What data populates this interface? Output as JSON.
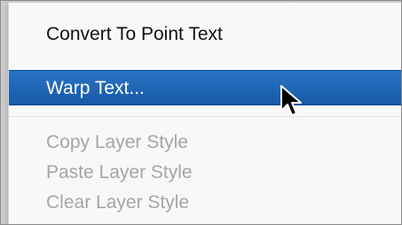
{
  "menu": {
    "items": [
      {
        "label": "Convert To Point Text",
        "state": "enabled"
      },
      {
        "label": "Warp Text...",
        "state": "highlighted"
      },
      {
        "label": "Copy Layer Style",
        "state": "disabled"
      },
      {
        "label": "Paste Layer Style",
        "state": "disabled"
      },
      {
        "label": "Clear Layer Style",
        "state": "disabled"
      }
    ]
  },
  "colors": {
    "highlight": "#1e63b3",
    "disabled_text": "#a5a5a5",
    "menu_background": "#fafafa"
  },
  "icons": {
    "cursor": "arrow-pointer-icon"
  }
}
